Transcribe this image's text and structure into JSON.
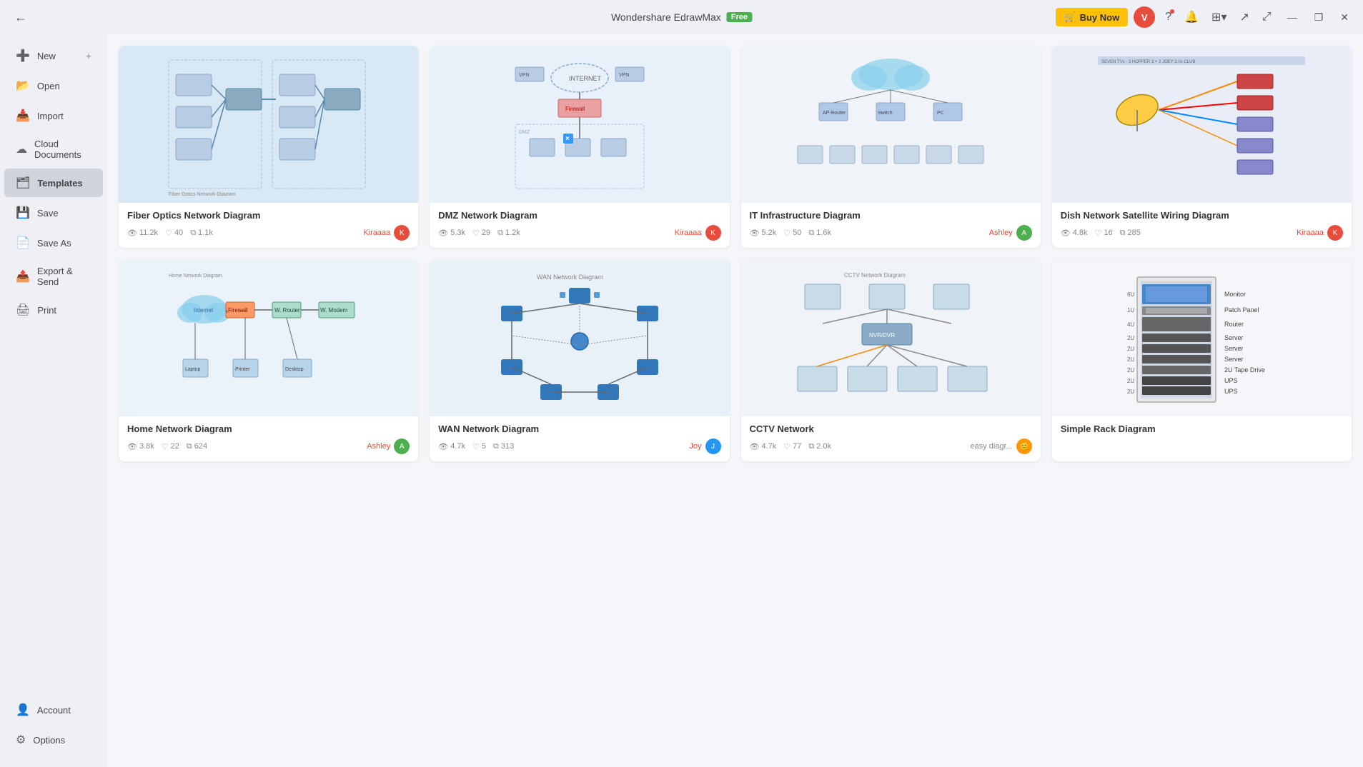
{
  "app": {
    "title": "Wondershare EdrawMax",
    "badge": "Free",
    "buy_now": "Buy Now"
  },
  "titlebar": {
    "user_initial": "V",
    "minimize": "—",
    "restore": "❐",
    "close": "✕"
  },
  "sidebar": {
    "items": [
      {
        "id": "new",
        "label": "New",
        "icon": "➕"
      },
      {
        "id": "open",
        "label": "Open",
        "icon": "📂"
      },
      {
        "id": "import",
        "label": "Import",
        "icon": "📥"
      },
      {
        "id": "cloud",
        "label": "Cloud Documents",
        "icon": "☁️"
      },
      {
        "id": "templates",
        "label": "Templates",
        "icon": "🗂"
      },
      {
        "id": "save",
        "label": "Save",
        "icon": "💾"
      },
      {
        "id": "save-as",
        "label": "Save As",
        "icon": "📄"
      },
      {
        "id": "export",
        "label": "Export & Send",
        "icon": "📤"
      },
      {
        "id": "print",
        "label": "Print",
        "icon": "🖨"
      }
    ],
    "bottom": [
      {
        "id": "account",
        "label": "Account",
        "icon": "👤"
      },
      {
        "id": "options",
        "label": "Options",
        "icon": "⚙️"
      }
    ]
  },
  "toolbar": {
    "help_icon": "?",
    "notification_icon": "🔔",
    "community_icon": "⚙",
    "share_icon": "↗",
    "expand_icon": "⤢"
  },
  "templates": [
    {
      "id": "fiber-optics",
      "title": "Fiber Optics Network Diagram",
      "views": "11.2k",
      "likes": "40",
      "copies": "1.1k",
      "author": "Kiraaaa",
      "avatar_color": "red",
      "bg": "#dbe8f5"
    },
    {
      "id": "dmz-network",
      "title": "DMZ Network Diagram",
      "views": "5.3k",
      "likes": "29",
      "copies": "1.2k",
      "author": "Kiraaaa",
      "avatar_color": "red",
      "bg": "#e8f0fa"
    },
    {
      "id": "it-infrastructure",
      "title": "IT Infrastructure Diagram",
      "views": "5.2k",
      "likes": "50",
      "copies": "1.6k",
      "author": "Ashley",
      "avatar_color": "green",
      "bg": "#f0f4f8"
    },
    {
      "id": "dish-network",
      "title": "Dish Network Satellite Wiring Diagram",
      "views": "4.8k",
      "likes": "16",
      "copies": "285",
      "author": "Kiraaaa",
      "avatar_color": "red",
      "bg": "#e8edf8"
    },
    {
      "id": "home-network",
      "title": "Home Network Diagram",
      "views": "3.8k",
      "likes": "22",
      "copies": "624",
      "author": "Ashley",
      "avatar_color": "green",
      "bg": "#eaf2fa"
    },
    {
      "id": "wan-network",
      "title": "WAN Network Diagram",
      "views": "4.7k",
      "likes": "5",
      "copies": "313",
      "author": "Joy",
      "avatar_color": "blue",
      "bg": "#e8f0f8"
    },
    {
      "id": "cctv-network",
      "title": "CCTV Network",
      "views": "4.7k",
      "likes": "77",
      "copies": "2.0k",
      "author": "easy diagr...",
      "avatar_color": "orange",
      "bg": "#f0f4f8"
    },
    {
      "id": "simple-rack",
      "title": "Simple Rack Diagram",
      "views": "",
      "likes": "",
      "copies": "",
      "author": "",
      "avatar_color": "blue",
      "bg": "#f5f6fa"
    }
  ]
}
